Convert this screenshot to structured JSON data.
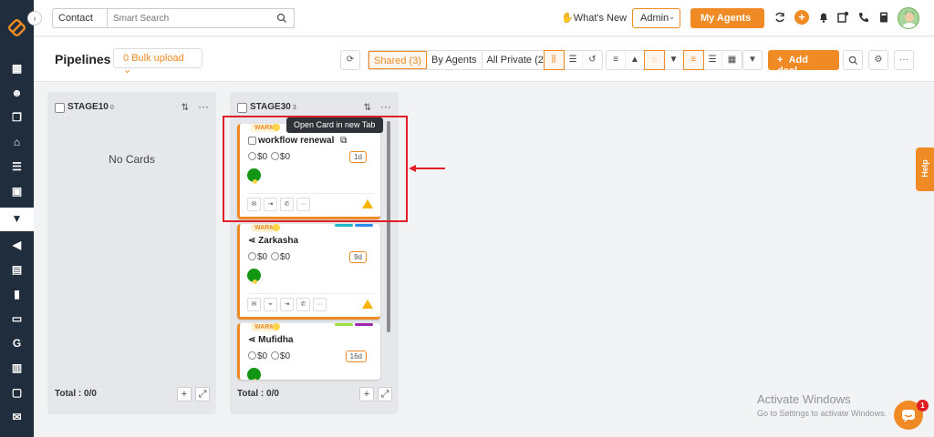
{
  "topbar": {
    "contact_select": "Contact",
    "search_placeholder": "Smart Search",
    "whats_new": "What's New",
    "admin_select": "Admin",
    "my_agents": "My Agents"
  },
  "subheader": {
    "title": "Pipelines",
    "bulk_upload": "0 Bulk upload",
    "shared": "Shared (3)",
    "by_agents": "By Agents",
    "all_private": "All Private (27)",
    "add_deal": "Add deal"
  },
  "columns": [
    {
      "title": "STAGE10",
      "count": "0",
      "empty_text": "No Cards",
      "total": "Total : 0/0"
    },
    {
      "title": "STAGE30",
      "count": "3",
      "total": "Total : 0/0"
    }
  ],
  "cards": [
    {
      "tag": "WARM",
      "name": "workflow renewal",
      "amount1": "$0",
      "amount2": "$0",
      "age": "1d"
    },
    {
      "tag": "WARM",
      "name": "Zarkasha",
      "amount1": "$0",
      "amount2": "$0",
      "age": "9d"
    },
    {
      "tag": "WARM",
      "name": "Mufidha",
      "amount1": "$0",
      "amount2": "$0",
      "age": "16d"
    }
  ],
  "tooltip": "Open Card in new Tab",
  "help_tab": "Help",
  "watermark": {
    "title": "Activate Windows",
    "subtitle": "Go to Settings to activate Windows."
  },
  "chat_badge": "1",
  "colors": {
    "accent": "#f08a24",
    "rail": "#1f2d3d",
    "annotation": "#e01f26",
    "status_green": "#139613"
  }
}
